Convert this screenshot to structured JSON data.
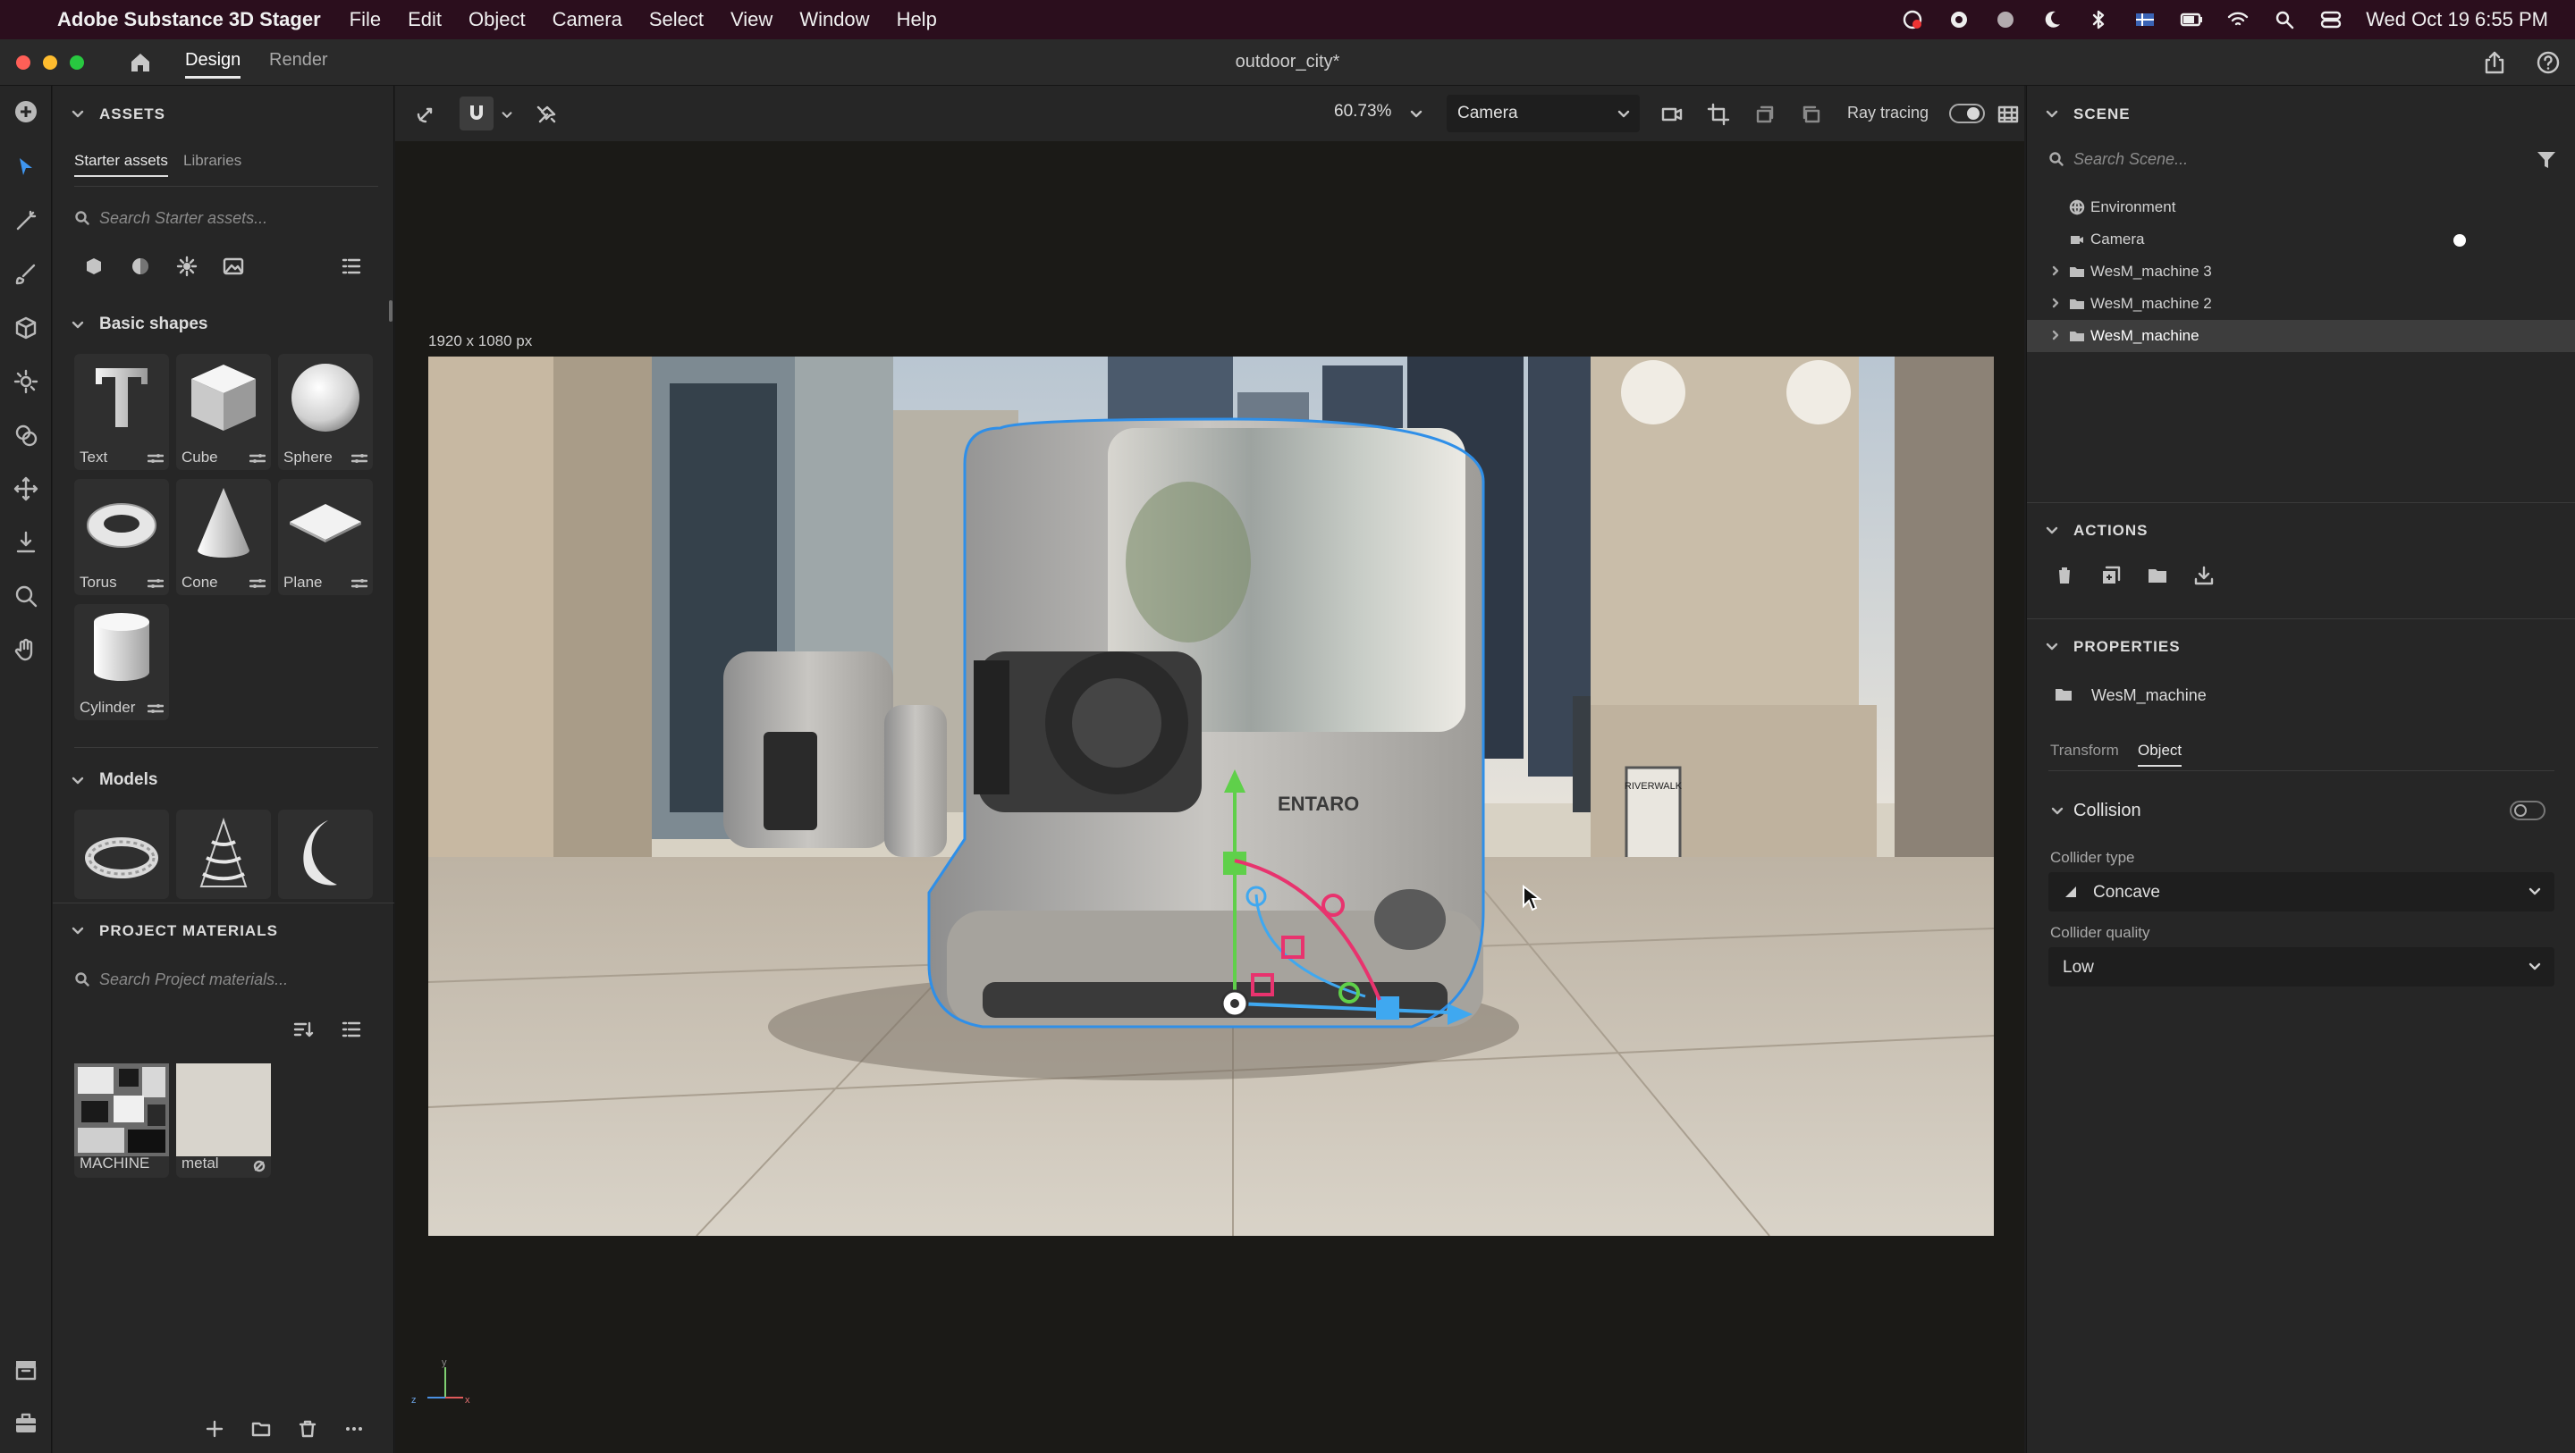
{
  "menubar": {
    "app_name": "Adobe Substance 3D Stager",
    "items": [
      "File",
      "Edit",
      "Object",
      "Camera",
      "Select",
      "View",
      "Window",
      "Help"
    ],
    "clock": "Wed Oct 19  6:55 PM"
  },
  "titlebar": {
    "tabs": [
      "Design",
      "Render"
    ],
    "doc_title": "outdoor_city*"
  },
  "assets": {
    "header": "ASSETS",
    "tabs": [
      "Starter assets",
      "Libraries"
    ],
    "search_placeholder": "Search Starter assets...",
    "basic_shapes_header": "Basic shapes",
    "shapes": [
      "Text",
      "Cube",
      "Sphere",
      "Torus",
      "Cone",
      "Plane",
      "Cylinder"
    ],
    "models_header": "Models",
    "project_materials_header": "PROJECT MATERIALS",
    "project_search_placeholder": "Search Project materials...",
    "materials": [
      "MACHINE",
      "metal"
    ]
  },
  "viewport": {
    "zoom": "60.73%",
    "camera_select": "Camera",
    "ray_tracing_label": "Ray tracing",
    "resolution": "1920 x 1080 px",
    "axis_y": "y",
    "axis_z": "z",
    "axis_x": "x",
    "brand_text": "ENTARO",
    "sign_text": "RIVERWALK"
  },
  "scene": {
    "header": "SCENE",
    "search_placeholder": "Search Scene...",
    "items": [
      "Environment",
      "Camera",
      "WesM_machine 3",
      "WesM_machine 2",
      "WesM_machine"
    ]
  },
  "actions": {
    "header": "ACTIONS"
  },
  "properties": {
    "header": "PROPERTIES",
    "object_name": "WesM_machine",
    "tabs": [
      "Transform",
      "Object"
    ],
    "collision_label": "Collision",
    "collider_type_label": "Collider type",
    "collider_type_value": "Concave",
    "collider_quality_label": "Collider quality",
    "collider_quality_value": "Low"
  },
  "colors": {
    "menubar_bg": "#2b0e1d",
    "panel_bg": "#262626",
    "gizmo_green": "#5fd04a",
    "gizmo_blue": "#3fa8f0",
    "gizmo_red": "#e8336e",
    "selection_outline": "#2f8fe8"
  }
}
